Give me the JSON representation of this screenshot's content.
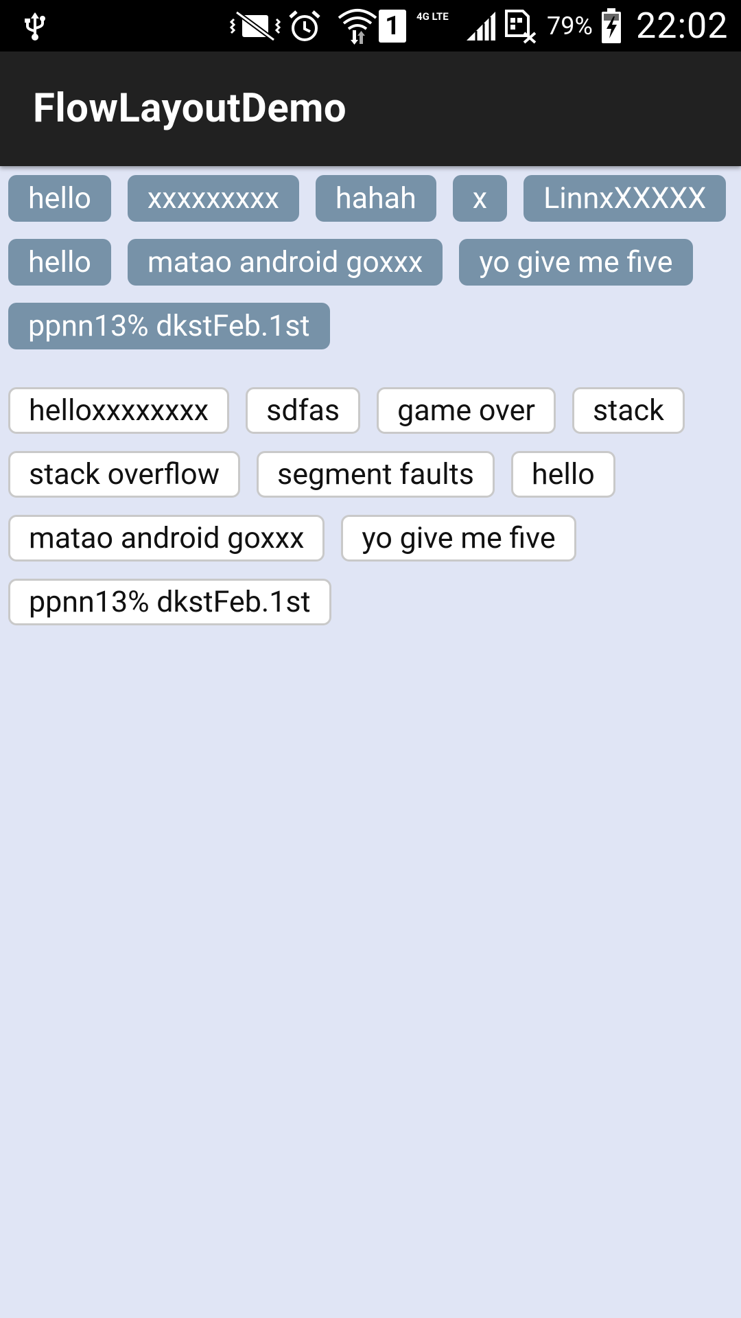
{
  "status_bar": {
    "battery_percent": "79%",
    "time": "22:02",
    "sim_slot": "1",
    "network_type": "4G LTE",
    "icons": [
      "usb-icon",
      "vibrate-icon",
      "alarm-icon",
      "wifi-icon",
      "sim-icon",
      "signal-icon",
      "no-sim-icon",
      "battery-charging-icon"
    ]
  },
  "app_bar": {
    "title": "FlowLayoutDemo"
  },
  "colors": {
    "background": "#e0e5f5",
    "app_bar": "#212121",
    "tag_filled": "#7792a8",
    "tag_outline_border": "#c9c9c9"
  },
  "flow_filled": {
    "tags": [
      "hello",
      "xxxxxxxxx",
      "hahah",
      "x",
      "LinnxXXXXX",
      "hello",
      "matao android goxxx",
      "yo give me five",
      "ppnn13% dkstFeb.1st"
    ]
  },
  "flow_outlined": {
    "tags": [
      "helloxxxxxxxx",
      "sdfas",
      "game over",
      "stack",
      "stack overflow",
      "segment faults",
      "hello",
      "matao android goxxx",
      "yo give me five",
      "ppnn13% dkstFeb.1st"
    ]
  }
}
